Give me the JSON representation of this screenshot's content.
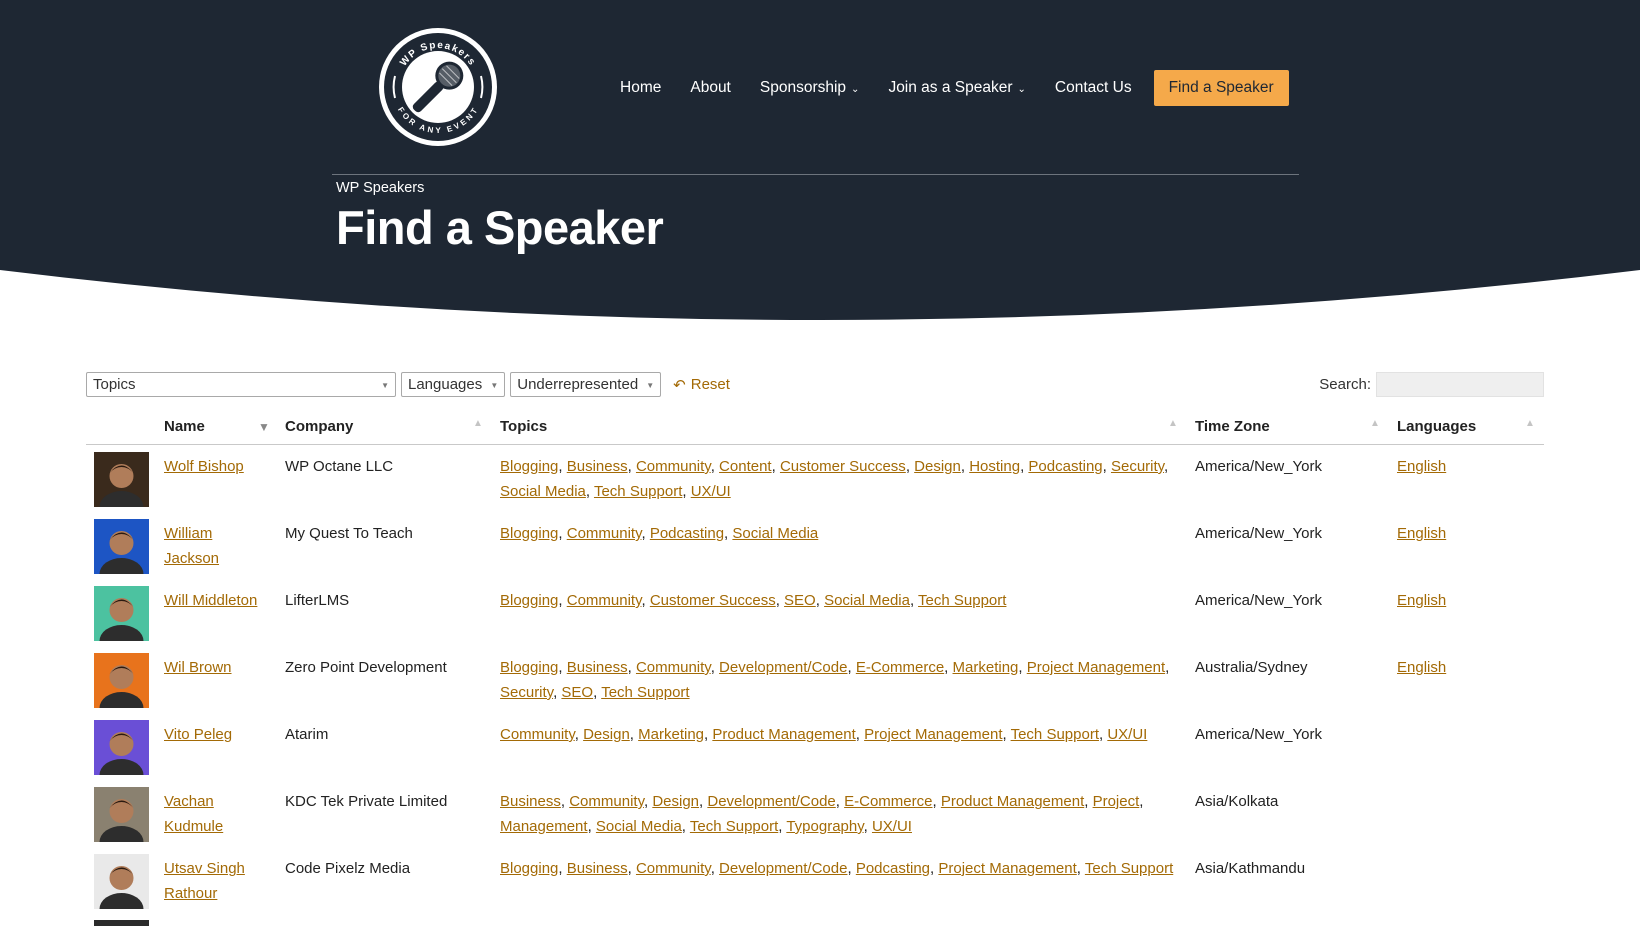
{
  "logo": {
    "top_text": "WP Speakers",
    "bottom_text": "FOR ANY EVENT"
  },
  "nav": {
    "items": [
      {
        "label": "Home",
        "has_dropdown": false
      },
      {
        "label": "About",
        "has_dropdown": false
      },
      {
        "label": "Sponsorship",
        "has_dropdown": true
      },
      {
        "label": "Join as a Speaker",
        "has_dropdown": true
      },
      {
        "label": "Contact Us",
        "has_dropdown": false
      }
    ],
    "cta_label": "Find a Speaker"
  },
  "header": {
    "breadcrumb": "WP Speakers",
    "title": "Find a Speaker"
  },
  "filters": {
    "topics": "Topics",
    "languages": "Languages",
    "underrepresented": "Underrepresented",
    "reset": "Reset",
    "search_label": "Search:",
    "search_value": ""
  },
  "table": {
    "columns": [
      "Name",
      "Company",
      "Topics",
      "Time Zone",
      "Languages"
    ],
    "rows": [
      {
        "name_lines": [
          "Wolf Bishop"
        ],
        "company": "WP Octane LLC",
        "topic_lines": [
          [
            "Blogging",
            "Business",
            "Community",
            "Content",
            "Customer Success",
            "Design",
            "Hosting",
            "Podcasting",
            "Security"
          ],
          [
            "Social Media",
            "Tech Support",
            "UX/UI"
          ]
        ],
        "timezone": "America/New_York",
        "language": "English",
        "avatar_color": "#3a2a1c"
      },
      {
        "name_lines": [
          "William",
          "Jackson"
        ],
        "company": "My Quest To Teach",
        "topic_lines": [
          [
            "Blogging",
            "Community",
            "Podcasting",
            "Social Media"
          ]
        ],
        "timezone": "America/New_York",
        "language": "English",
        "avatar_color": "#1d55c4"
      },
      {
        "name_lines": [
          "Will Middleton"
        ],
        "company": "LifterLMS",
        "topic_lines": [
          [
            "Blogging",
            "Community",
            "Customer Success",
            "SEO",
            "Social Media",
            "Tech Support"
          ]
        ],
        "timezone": "America/New_York",
        "language": "English",
        "avatar_color": "#4cc2a0"
      },
      {
        "name_lines": [
          "Wil Brown"
        ],
        "company": "Zero Point Development",
        "topic_lines": [
          [
            "Blogging",
            "Business",
            "Community",
            "Development/Code",
            "E-Commerce",
            "Marketing",
            "Project Management"
          ],
          [
            "Security",
            "SEO",
            "Tech Support"
          ]
        ],
        "timezone": "Australia/Sydney",
        "language": "English",
        "avatar_color": "#e8731c"
      },
      {
        "name_lines": [
          "Vito Peleg"
        ],
        "company": "Atarim",
        "topic_lines": [
          [
            "Community",
            "Design",
            "Marketing",
            "Product Management",
            "Project Management",
            "Tech Support",
            "UX/UI"
          ]
        ],
        "timezone": "America/New_York",
        "language": "",
        "avatar_color": "#6a4fd6"
      },
      {
        "name_lines": [
          "Vachan",
          "Kudmule"
        ],
        "company": "KDC Tek Private Limited",
        "topic_lines": [
          [
            "Business",
            "Community",
            "Design",
            "Development/Code",
            "E-Commerce",
            "Product Management",
            "Project"
          ],
          [
            "Management",
            "Social Media",
            "Tech Support",
            "Typography",
            "UX/UI"
          ]
        ],
        "timezone": "Asia/Kolkata",
        "language": "",
        "avatar_color": "#8a8170"
      },
      {
        "name_lines": [
          "Utsav Singh",
          "Rathour"
        ],
        "company": "Code Pixelz Media",
        "topic_lines": [
          [
            "Blogging",
            "Business",
            "Community",
            "Development/Code",
            "Podcasting",
            "Project Management",
            "Tech Support"
          ]
        ],
        "timezone": "Asia/Kathmandu",
        "language": "",
        "avatar_color": "#e9e9e9"
      }
    ]
  },
  "colors": {
    "header_bg": "#1e2733",
    "accent": "#f5a94a",
    "link": "#a36a06"
  }
}
